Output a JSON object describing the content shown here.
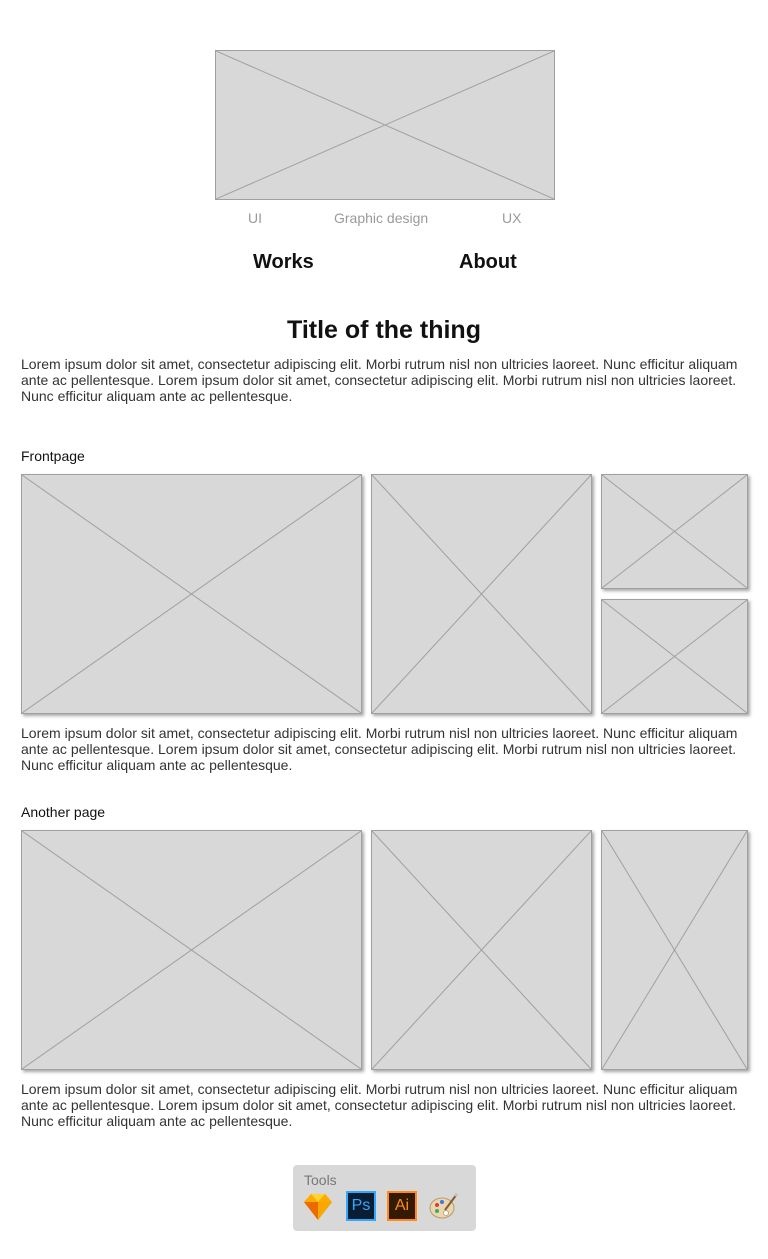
{
  "header": {
    "tags": [
      "UI",
      "Graphic design",
      "UX"
    ],
    "nav": {
      "works": "Works",
      "about": "About"
    }
  },
  "content": {
    "title": "Title of the thing",
    "intro": "Lorem ipsum dolor sit amet, consectetur adipiscing elit. Morbi rutrum nisl non ultricies laoreet. Nunc efficitur aliquam ante ac pellentesque. Lorem ipsum dolor sit amet, consectetur adipiscing elit. Morbi rutrum nisl non ultricies laoreet. Nunc efficitur aliquam ante ac pellentesque.",
    "sections": [
      {
        "label": "Frontpage",
        "text": "Lorem ipsum dolor sit amet, consectetur adipiscing elit. Morbi rutrum nisl non ultricies laoreet. Nunc efficitur aliquam ante ac pellentesque. Lorem ipsum dolor sit amet, consectetur adipiscing elit. Morbi rutrum nisl non ultricies laoreet. Nunc efficitur aliquam ante ac pellentesque."
      },
      {
        "label": "Another page",
        "text": "Lorem ipsum dolor sit amet, consectetur adipiscing elit. Morbi rutrum nisl non ultricies laoreet. Nunc efficitur aliquam ante ac pellentesque. Lorem ipsum dolor sit amet, consectetur adipiscing elit. Morbi rutrum nisl non ultricies laoreet. Nunc efficitur aliquam ante ac pellentesque."
      }
    ]
  },
  "tools": {
    "label": "Tools",
    "items": [
      {
        "icon": "sketch-icon",
        "text": ""
      },
      {
        "icon": "photoshop-icon",
        "text": "Ps"
      },
      {
        "icon": "illustrator-icon",
        "text": "Ai"
      },
      {
        "icon": "paint-palette-icon",
        "text": ""
      }
    ]
  },
  "colors": {
    "placeholder_fill": "#d8d8d8",
    "placeholder_stroke": "#a0a0a0",
    "tag_text": "#9a9a9a",
    "photoshop_accent": "#31a8ff",
    "illustrator_accent": "#ff8a1a",
    "sketch_accent": "#f7b500"
  }
}
